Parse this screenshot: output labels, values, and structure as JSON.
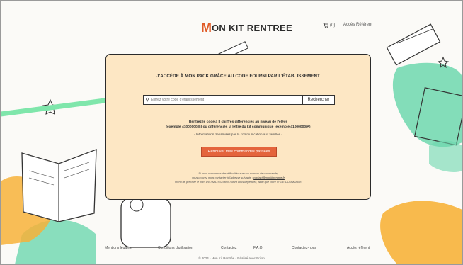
{
  "header": {
    "logo_initial": "M",
    "logo_text": "ON KIT RENTREE",
    "cart_count": "(0)",
    "pro_label": "Accès Référent"
  },
  "card": {
    "title": "J'ACCÈDE À MON PACK GRÂCE AU CODE FOURNI PAR L'ÉTABLISSEMENT",
    "search_placeholder": "Entrez votre code d'établissement",
    "search_button": "Rechercher",
    "info_line1": "Rentrez le code à 8 chiffres différenciés au niveau de l'élève",
    "info_line2": "(exemple 41000000/B) ou différenciés la lettre du kit communiqué (exemple 41000000/A)",
    "info_note": "- Informations transmises par la communication aux familles -",
    "orders_button": "Retrouver mes commandes passées",
    "help_line1": "Si vous rencontrez des difficultés avec ce numéro de commande,",
    "help_line2_prefix": "vous pouvez nous contacter à l'adresse suivante :",
    "help_email": "contact@monkitrentree.fr",
    "help_line3": "merci de préciser le nom D'ÉTABLISSEMENT dont vous dépendez, ainsi que votre N° DE COMMANDE"
  },
  "footer": {
    "links": [
      "Mentions légales",
      "Conditions d'utilisation",
      "Contactez",
      "F.A.Q.",
      "Contactez-nous",
      "Accès référent"
    ],
    "copyright": "© 2024 - Mon Kit Rentrée - Réalisé avec Prism"
  },
  "colors": {
    "accent": "#e05a26",
    "card_bg": "#fde7c4",
    "arrow": "#7fe6ab",
    "teal_deco": "#6dd7ae",
    "orange_deco": "#f7b23a"
  }
}
